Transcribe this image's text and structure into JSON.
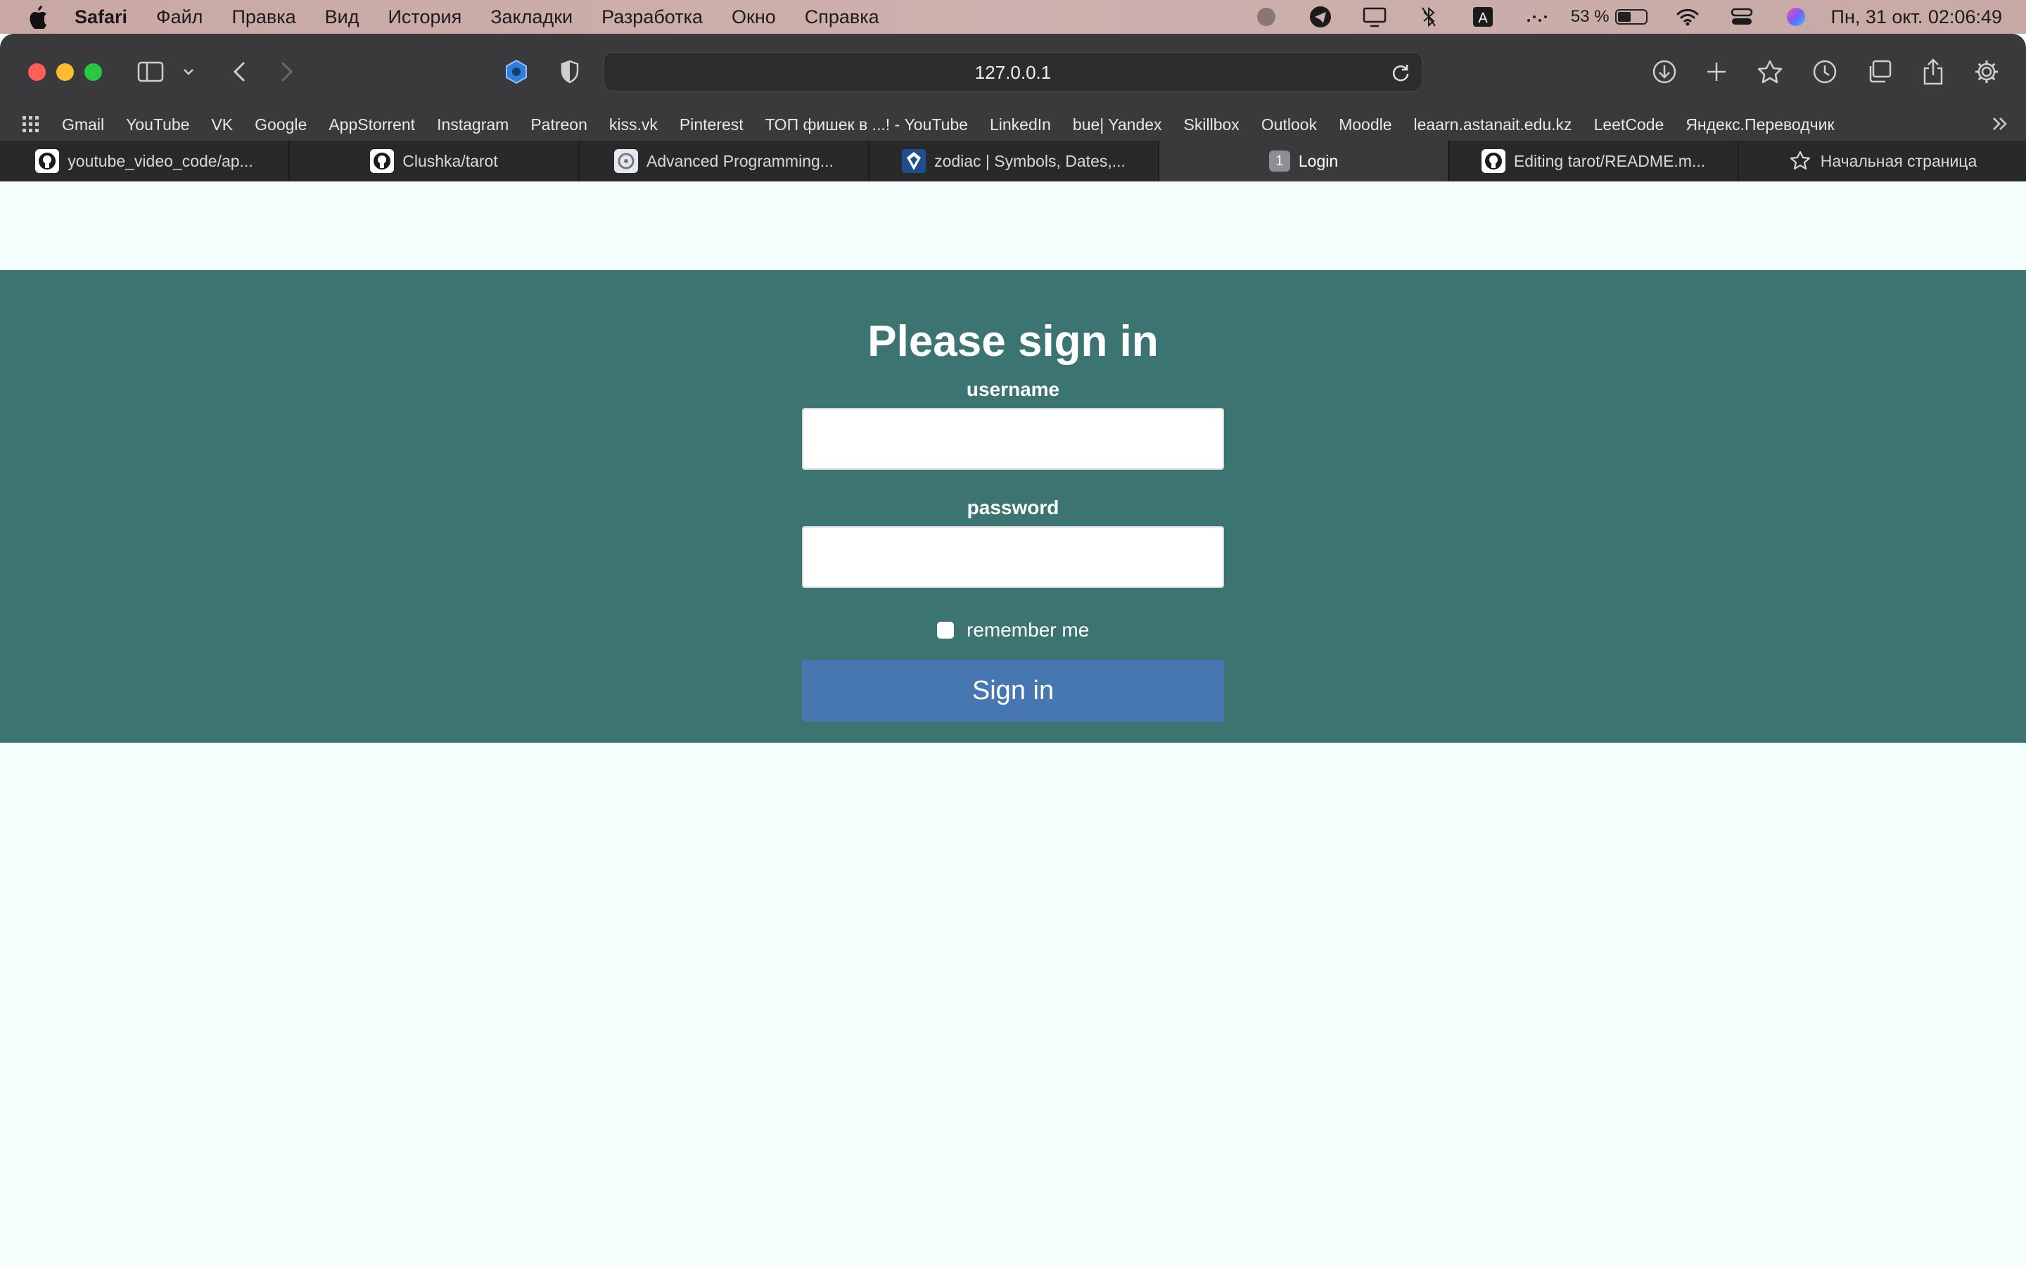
{
  "menubar": {
    "app_name": "Safari",
    "items": [
      "Файл",
      "Правка",
      "Вид",
      "История",
      "Закладки",
      "Разработка",
      "Окно",
      "Справка"
    ],
    "battery_percent": "53 %",
    "clock": "Пн, 31 окт.  02:06:49",
    "battery_level": 0.53
  },
  "toolbar": {
    "url": "127.0.0.1"
  },
  "bookmarks": [
    "Gmail",
    "YouTube",
    "VK",
    "Google",
    "AppStorrent",
    "Instagram",
    "Patreon",
    "kiss.vk",
    "Pinterest",
    "ТОП фишек в ...! - YouTube",
    "LinkedIn",
    "bue| Yandex",
    "Skillbox",
    "Outlook",
    "Moodle",
    "leaarn.astanait.edu.kz",
    "LeetCode",
    "Яндекс.Переводчик"
  ],
  "tabs": [
    {
      "label": "youtube_video_code/ap...",
      "icon": "github-icon"
    },
    {
      "label": "Clushka/tarot",
      "icon": "github-icon"
    },
    {
      "label": "Advanced Programming...",
      "icon": "course-icon"
    },
    {
      "label": "zodiac | Symbols, Dates,...",
      "icon": "britannica-icon"
    },
    {
      "label": "Login",
      "icon": "number-badge",
      "badge": "1",
      "active": true
    },
    {
      "label": "Editing tarot/README.m...",
      "icon": "github-icon"
    },
    {
      "label": "Начальная страница",
      "icon": "star-icon"
    }
  ],
  "page": {
    "title": "Please sign in",
    "username_label": "username",
    "username_value": "",
    "password_label": "password",
    "password_value": "",
    "remember_label": "remember me",
    "signin_label": "Sign in"
  },
  "colors": {
    "panel": "#3b7470",
    "button": "#4677b0",
    "page_bg": "#f4fffd"
  }
}
